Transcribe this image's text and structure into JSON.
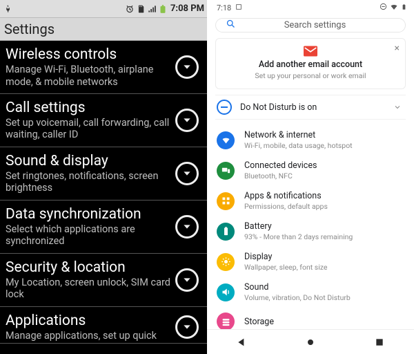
{
  "left": {
    "statusbar": {
      "time": "7:08 PM"
    },
    "title": "Settings",
    "items": [
      {
        "title": "Wireless controls",
        "sub": "Manage Wi-Fi, Bluetooth, airplane mode, & mobile networks"
      },
      {
        "title": "Call settings",
        "sub": "Set up voicemail, call forwarding, call waiting, caller ID"
      },
      {
        "title": "Sound & display",
        "sub": "Set ringtones, notifications, screen brightness"
      },
      {
        "title": "Data synchronization",
        "sub": "Select which applications are synchronized"
      },
      {
        "title": "Security & location",
        "sub": "My Location, screen unlock, SIM card lock"
      },
      {
        "title": "Applications",
        "sub": "Manage applications, set up quick"
      }
    ]
  },
  "right": {
    "statusbar": {
      "time": "7:18"
    },
    "search": {
      "placeholder": "Search settings"
    },
    "card": {
      "title": "Add another email account",
      "sub": "Set up your personal or work email"
    },
    "dnd": {
      "label": "Do Not Disturb is on"
    },
    "items": [
      {
        "title": "Network & internet",
        "sub": "Wi-Fi, mobile, data usage, hotspot",
        "color": "blue",
        "icon": "wifi"
      },
      {
        "title": "Connected devices",
        "sub": "Bluetooth, NFC",
        "color": "green",
        "icon": "devices"
      },
      {
        "title": "Apps & notifications",
        "sub": "Permissions, default apps",
        "color": "orange",
        "icon": "apps"
      },
      {
        "title": "Battery",
        "sub": "93% - More than 2 days remaining",
        "color": "teal",
        "icon": "battery"
      },
      {
        "title": "Display",
        "sub": "Wallpaper, sleep, font size",
        "color": "yellow",
        "icon": "display"
      },
      {
        "title": "Sound",
        "sub": "Volume, vibration, Do Not Disturb",
        "color": "cyan",
        "icon": "sound"
      },
      {
        "title": "Storage",
        "sub": "",
        "color": "pink",
        "icon": "storage"
      }
    ]
  }
}
